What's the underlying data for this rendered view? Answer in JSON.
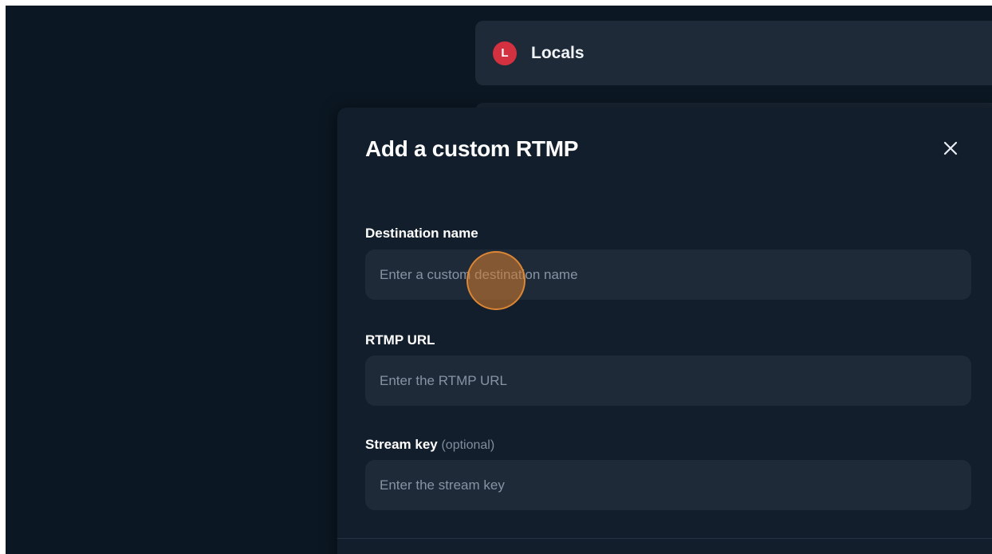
{
  "destination": {
    "avatar_letter": "L",
    "name": "Locals",
    "avatar_color": "#d3313f"
  },
  "modal": {
    "title": "Add a custom RTMP",
    "close_icon": "close-icon",
    "fields": [
      {
        "label": "Destination name",
        "suffix": "",
        "placeholder": "Enter a custom destination name",
        "value": ""
      },
      {
        "label": "RTMP URL",
        "suffix": "",
        "placeholder": "Enter the RTMP URL",
        "value": ""
      },
      {
        "label": "Stream key",
        "suffix": "(optional)",
        "placeholder": "Enter the stream key",
        "value": ""
      }
    ]
  },
  "colors": {
    "background": "#0b1722",
    "modal": "#121e2b",
    "input": "#1f2a39",
    "cursor_highlight": "#d67e2e"
  }
}
